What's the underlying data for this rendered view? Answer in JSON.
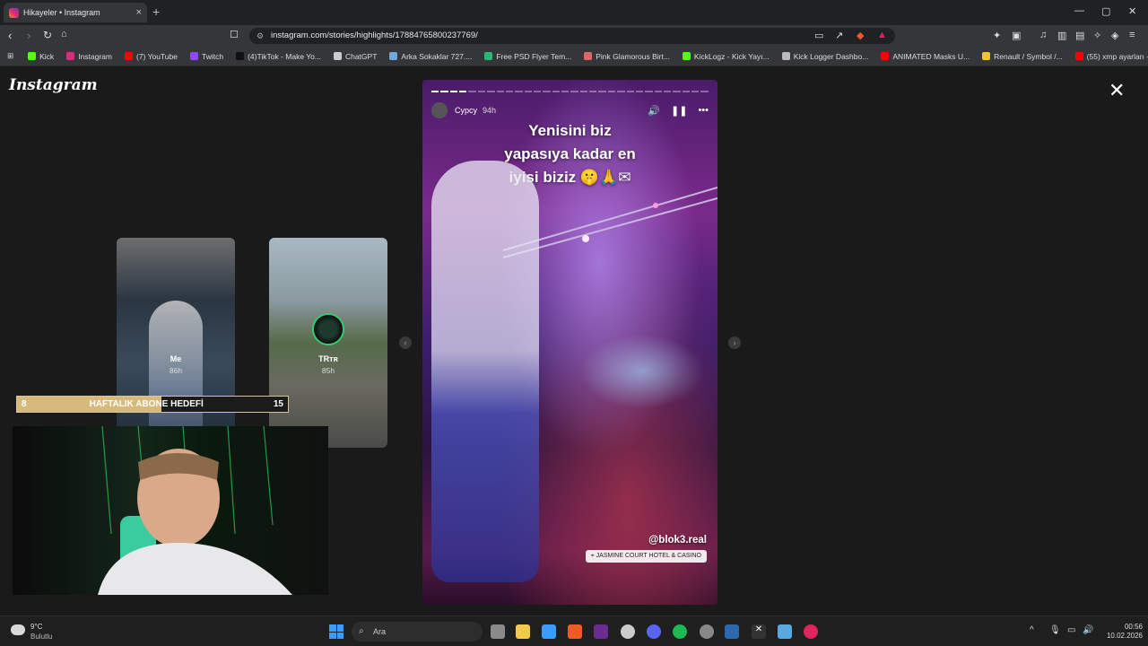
{
  "browser": {
    "tab_title": "Hikayeler • Instagram",
    "tab_close": "×",
    "new_tab": "+",
    "url": "instagram.com/stories/highlights/17884765800237769/",
    "bookmarks": [
      {
        "label": "Kick",
        "color": "#53fc18"
      },
      {
        "label": "Instagram",
        "color": "#dd2a7b"
      },
      {
        "label": "(7) YouTube",
        "color": "#ff0000"
      },
      {
        "label": "Twitch",
        "color": "#9146ff"
      },
      {
        "label": "(4)TikTok - Make Yo...",
        "color": "#111111"
      },
      {
        "label": "ChatGPT",
        "color": "#cccccc"
      },
      {
        "label": "Arka Sokaklar 727....",
        "color": "#6fa8dc"
      },
      {
        "label": "Free PSD Flyer Tem...",
        "color": "#2bb673"
      },
      {
        "label": "Pink Glamorous Birt...",
        "color": "#e06666"
      },
      {
        "label": "KickLogz - Kick Yayı...",
        "color": "#53fc18"
      },
      {
        "label": "Kick Logger Dashbo...",
        "color": "#bbbbbb"
      },
      {
        "label": "ANIMATED Masks U...",
        "color": "#ff0000"
      },
      {
        "label": "Renault / Symbol /...",
        "color": "#f1c232"
      },
      {
        "label": "(55) xmp ayarları - Y...",
        "color": "#ff0000"
      }
    ]
  },
  "instagram": {
    "logo": "Instagram",
    "close": "✕",
    "previews": [
      {
        "name": "Me",
        "time": "86h"
      },
      {
        "name": "TRᴛʀ",
        "time": "85h"
      }
    ],
    "story": {
      "username": "Cypcy",
      "time": "94h",
      "caption_lines": [
        "Yenisini biz",
        "yapasıya kadar en",
        "iyisi biziz 🤫🙏✉"
      ],
      "mention": "@blok3.real",
      "location": "JASMINE COURT HOTEL & CASINO",
      "progress_segments": 30,
      "progress_done": 4
    }
  },
  "overlay": {
    "goal_current": "8",
    "goal_label": "HAFTALIK ABONE HEDEFİ",
    "goal_target": "15",
    "goal_fraction": 0.533
  },
  "taskbar": {
    "weather_temp": "9°C",
    "weather_desc": "Bulutlu",
    "search_placeholder": "Ara",
    "time": "00:56",
    "date": "10.02.2026"
  },
  "colors": {
    "accent_goal": "#d6b97b",
    "story_bg": "#4a1c6a",
    "windows_blue": "#3b9cff"
  }
}
